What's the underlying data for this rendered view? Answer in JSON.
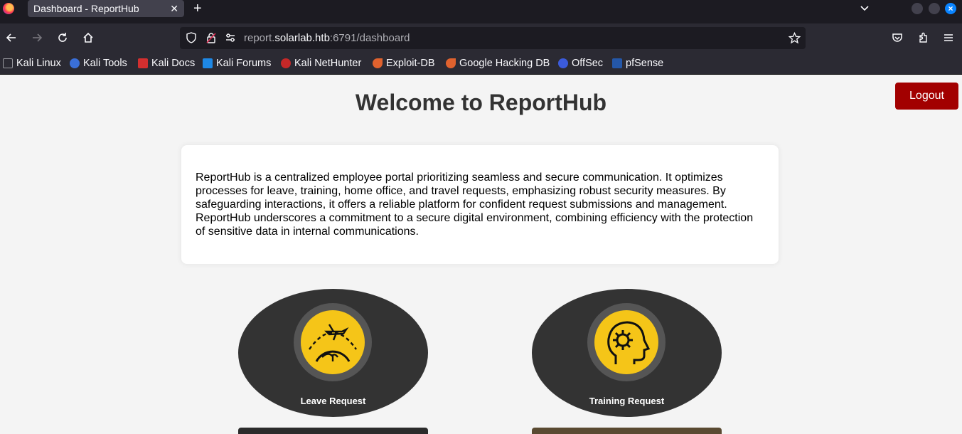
{
  "browser": {
    "tab_title": "Dashboard - ReportHub",
    "tab_close": "✕",
    "new_tab": "+",
    "url_host_pre": "report.",
    "url_host_main": "solarlab.htb",
    "url_rest": ":6791/dashboard",
    "bookmarks": [
      {
        "label": "Kali Linux",
        "color": "#2b2a33"
      },
      {
        "label": "Kali Tools",
        "color": "#3a6fd8"
      },
      {
        "label": "Kali Docs",
        "color": "#d32f2f"
      },
      {
        "label": "Kali Forums",
        "color": "#1e88e5"
      },
      {
        "label": "Kali NetHunter",
        "color": "#c62828"
      },
      {
        "label": "Exploit-DB",
        "color": "#e0622e"
      },
      {
        "label": "Google Hacking DB",
        "color": "#e0622e"
      },
      {
        "label": "OffSec",
        "color": "#3b5bdb"
      },
      {
        "label": "pfSense",
        "color": "#2457a8"
      }
    ]
  },
  "page": {
    "heading": "Welcome to ReportHub",
    "logout_label": "Logout",
    "intro": "ReportHub is a centralized employee portal prioritizing seamless and secure communication. It optimizes processes for leave, training, home office, and travel requests, emphasizing robust security measures. By safeguarding interactions, it offers a reliable platform for confident request submissions and management. ReportHub underscores a commitment to a secure digital environment, combining efficiency with the protection of sensitive data in internal communications.",
    "tiles": [
      {
        "label": "Leave Request",
        "icon": "travel-globe-icon"
      },
      {
        "label": "Training Request",
        "icon": "head-gear-icon"
      }
    ]
  },
  "colors": {
    "accent_yellow": "#f5c518",
    "logout_red": "#a20000",
    "tile_dark": "#333333"
  }
}
